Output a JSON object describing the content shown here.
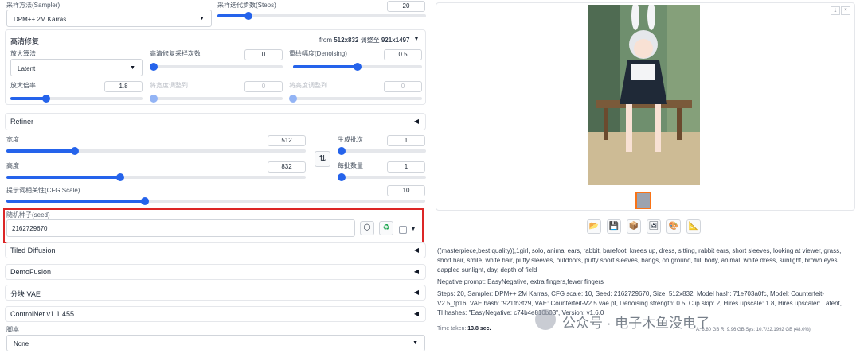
{
  "sampler": {
    "label": "采样方法(Sampler)",
    "value": "DPM++ 2M Karras"
  },
  "steps": {
    "label": "采样迭代步数(Steps)",
    "value": "20",
    "fraction": 0.15
  },
  "hires": {
    "title": "高清修复",
    "size_prefix": "from ",
    "size_from": "512x832",
    "size_mid": " 调整至 ",
    "size_to": "921x1497",
    "upscaler_label": "放大算法",
    "upscaler_value": "Latent",
    "hires_steps_label": "高清修复采样次数",
    "hires_steps_value": "0",
    "hires_steps_fraction": 0.0,
    "denoise_label": "重绘幅度(Denoising)",
    "denoise_value": "0.5",
    "denoise_fraction": 0.5,
    "upscale_by_label": "放大倍率",
    "upscale_by_value": "1.8",
    "upscale_by_fraction": 0.27,
    "resize_w_label": "将宽度调整到",
    "resize_w_value": "0",
    "resize_h_label": "将高度调整到",
    "resize_h_value": "0"
  },
  "refiner": {
    "title": "Refiner"
  },
  "width": {
    "label": "宽度",
    "value": "512",
    "fraction": 0.23
  },
  "height": {
    "label": "高度",
    "value": "832",
    "fraction": 0.38
  },
  "batch_count": {
    "label": "生成批次",
    "value": "1",
    "fraction": 0.0
  },
  "batch_size": {
    "label": "每批数量",
    "value": "1",
    "fraction": 0.0
  },
  "swap_icon": "⇅",
  "cfg": {
    "label": "提示词相关性(CFG Scale)",
    "value": "10",
    "fraction": 0.33
  },
  "seed": {
    "label": "随机种子(seed)",
    "value": "2162729670"
  },
  "accordions": [
    "Tiled Diffusion",
    "DemoFusion",
    "分块 VAE",
    "ControlNet v1.1.455"
  ],
  "script": {
    "label": "脚本",
    "value": "None"
  },
  "tool_icons": [
    "folder-icon",
    "save-icon",
    "archive-icon",
    "image-icon",
    "palette-icon",
    "ruler-icon"
  ],
  "info": {
    "prompt": "((masterpiece,best quality)),1girl, solo, animal ears, rabbit, barefoot, knees up, dress, sitting, rabbit ears, short sleeves, looking at viewer, grass, short hair, smile, white hair, puffy sleeves, outdoors, puffy short sleeves, bangs, on ground, full body, animal, white dress, sunlight, brown eyes, dappled sunlight, day, depth of field",
    "negative": "Negative prompt: EasyNegative, extra fingers,fewer fingers",
    "params": "Steps: 20, Sampler: DPM++ 2M Karras, CFG scale: 10, Seed: 2162729670, Size: 512x832, Model hash: 71e703a0fc, Model: Counterfeit-V2.5_fp16, VAE hash: f921fb3f29, VAE: Counterfeit-V2.5.vae.pt, Denoising strength: 0.5, Clip skip: 2, Hires upscale: 1.8, Hires upscaler: Latent, TI hashes: \"EasyNegative: c74b4e810b03\", Version: v1.6.0"
  },
  "footer": {
    "time_label": "Time taken: ",
    "time_value": "13.8 sec.",
    "vram_a": "A: 6.80 GB",
    "vram_r": "R: 9.96 GB",
    "vram_sys": "Sys: 10.7/22.1992 GB (48.0%)"
  },
  "watermark": "公众号 · 电子木鱼没电了",
  "colors": {
    "accent": "#2563eb",
    "highlight_border": "#dc2626"
  }
}
